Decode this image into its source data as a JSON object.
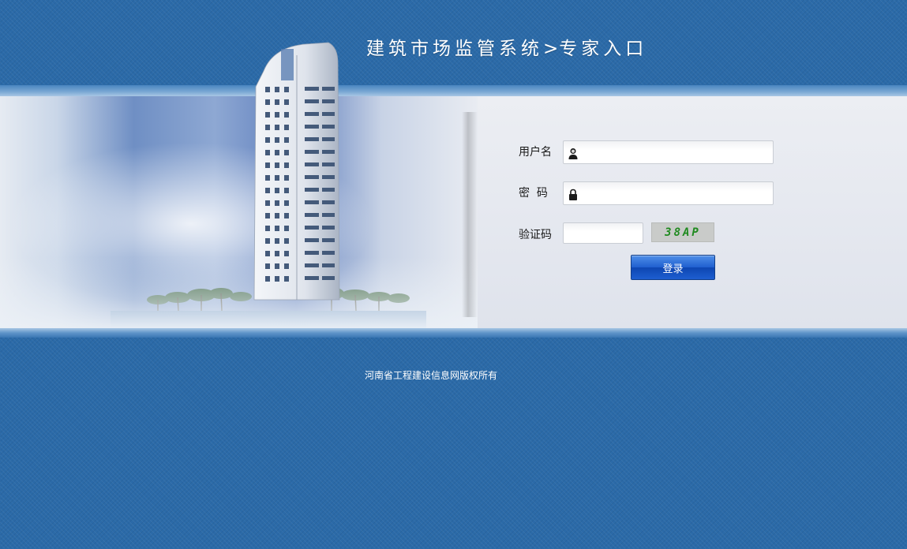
{
  "header": {
    "title_main": "建筑市场监管系统",
    "title_separator": ">",
    "title_sub": "专家入口"
  },
  "login_form": {
    "username_label": "用户名",
    "username_value": "",
    "username_icon": "user-icon",
    "password_label": "密  码",
    "password_value": "",
    "password_icon": "lock-icon",
    "captcha_label": "验证码",
    "captcha_value": "",
    "captcha_image_text": "38AP",
    "login_button": "登录"
  },
  "footer": {
    "copyright": "河南省工程建设信息网版权所有"
  },
  "colors": {
    "background": "#2b6aa8",
    "button": "#1f5fcf",
    "captcha_text": "#1f8a1f",
    "panel": "#e4e7ee"
  }
}
